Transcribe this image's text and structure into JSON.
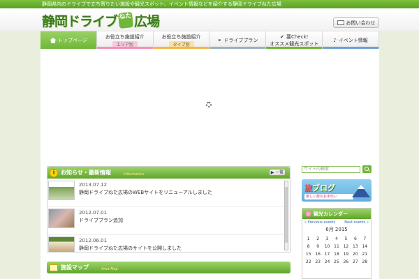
{
  "top_strip": {
    "text": "静岡県内のドライブで立ち寄りたい施設や観光スポット、イベント情報などを紹介する静岡ドライブねた広場"
  },
  "logo": {
    "part1": "静岡ドライブ",
    "badge": "ねた",
    "part2": "広場"
  },
  "header": {
    "contact_label": "お問い合わせ"
  },
  "nav": {
    "items": [
      {
        "label": "トップページ",
        "sub": "",
        "active": true,
        "bar_color": "#6fb737"
      },
      {
        "label": "お役立ち施設紹介",
        "sub": "エリア別",
        "active": false,
        "bar_color": "#f090b8"
      },
      {
        "label": "お役立ち施設紹介",
        "sub": "タイプ別",
        "active": false,
        "bar_color": "#f5b640"
      },
      {
        "label": "ドライブプラン",
        "sub": "",
        "active": false,
        "bar_color": "#9ab0c0"
      },
      {
        "label": "要Check!",
        "sub": "オススメ観光スポット",
        "active": false,
        "bar_color": "#6fb737"
      },
      {
        "label": "イベント情報",
        "sub": "",
        "active": false,
        "bar_color": "#6aa0d8"
      }
    ]
  },
  "news": {
    "title": "お知らせ・最新情報",
    "subtitle": "Information",
    "more_label": "▶ 一覧",
    "items": [
      {
        "date": "2013.07.12",
        "title": "静岡ドライブねた広場のWEBサイトをリニューアルしました"
      },
      {
        "date": "2012.07.01",
        "title": "ドライブプラン追加"
      },
      {
        "date": "2012.06.01",
        "title": "静岡ドライブねた広場のサイトを公開しました"
      }
    ]
  },
  "facility_map": {
    "title": "施設マップ",
    "subtitle": "Area Map"
  },
  "sidebar": {
    "search_placeholder": "サイト内検索",
    "banner_title_kanji": "旅",
    "banner_title_rest": "ブログ",
    "banner_sub": "楽しい旅のお手伝い",
    "calendar": {
      "title": "観光カレンダー",
      "prev": "« Previous events",
      "next": "Next events »",
      "month": "6月 2015",
      "cells": [
        "",
        "",
        "",
        "",
        "",
        "",
        "",
        "1",
        "2",
        "3",
        "4",
        "5",
        "6",
        "7",
        "8",
        "9",
        "10",
        "11",
        "12",
        "13",
        "14",
        "15",
        "16",
        "17",
        "18",
        "19",
        "20",
        "21",
        "22",
        "23",
        "24",
        "25",
        "26",
        "27",
        "28"
      ]
    }
  }
}
